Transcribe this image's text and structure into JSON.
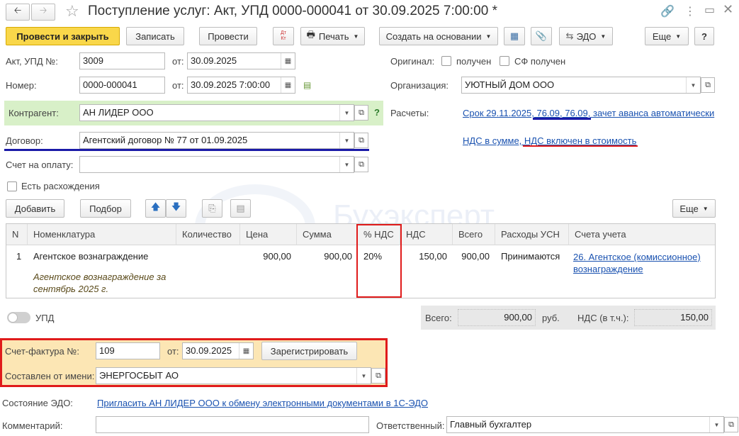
{
  "window": {
    "title": "Поступление услуг: Акт, УПД 0000-000041 от 30.09.2025 7:00:00 *"
  },
  "toolbar": {
    "post_close": "Провести и закрыть",
    "save": "Записать",
    "post": "Провести",
    "dt_kt": "Дт Кт",
    "print": "Печать",
    "create_based": "Создать на основании",
    "edo": "ЭДО",
    "more": "Еще",
    "help": "?"
  },
  "header": {
    "act_label": "Акт, УПД №:",
    "act_number": "3009",
    "from_label": "от:",
    "act_date": "30.09.2025",
    "number_label": "Номер:",
    "number_value": "0000-000041",
    "number_date": "30.09.2025  7:00:00",
    "original_label": "Оригинал:",
    "received_label": "получен",
    "sf_received_label": "СФ получен",
    "org_label": "Организация:",
    "org_value": "УЮТНЫЙ ДОМ ООО",
    "counterparty_label": "Контрагент:",
    "counterparty_value": "АН ЛИДЕР ООО",
    "help_q": "?",
    "settlements_label": "Расчеты:",
    "settlements_link": "Срок 29.11.2025, 76.09, 76.09, зачет аванса автоматически",
    "contract_label": "Договор:",
    "contract_value": "Агентский договор № 77 от 01.09.2025",
    "vat_link": "НДС в сумме, НДС включен в стоимость",
    "invoice_label": "Счет на оплату:",
    "invoice_value": "",
    "discrepancy_label": "Есть расхождения"
  },
  "table_toolbar": {
    "add": "Добавить",
    "pick": "Подбор",
    "more": "Еще"
  },
  "watermark": "Бухэксперт",
  "table": {
    "headers": [
      "N",
      "Номенклатура",
      "Количество",
      "Цена",
      "Сумма",
      "% НДС",
      "НДС",
      "Всего",
      "Расходы УСН",
      "Счета учета"
    ],
    "rows": [
      {
        "n": "1",
        "name": "Агентское вознаграждение",
        "content": "Агентское вознаграждение за сентябрь 2025 г.",
        "quantity": "",
        "price": "900,00",
        "sum": "900,00",
        "vat_rate": "20%",
        "vat": "150,00",
        "total": "900,00",
        "usn": "Принимаются",
        "account": "26. Агентское (комиссионное) вознаграждение"
      }
    ]
  },
  "totals": {
    "upd_label": "УПД",
    "total_label": "Всего:",
    "total_value": "900,00",
    "currency": "руб.",
    "vat_label": "НДС (в т.ч.):",
    "vat_value": "150,00"
  },
  "sf": {
    "number_label": "Счет-фактура №:",
    "number_value": "109",
    "from_label": "от:",
    "date_value": "30.09.2025",
    "register_button": "Зарегистрировать",
    "issuer_label": "Составлен от имени:",
    "issuer_value": "ЭНЕРГОСБЫТ АО"
  },
  "footer": {
    "edo_label": "Состояние ЭДО:",
    "edo_link": "Пригласить АН ЛИДЕР ООО к обмену электронными документами в 1С-ЭДО",
    "comment_label": "Комментарий:",
    "comment_value": "",
    "responsible_label": "Ответственный:",
    "responsible_value": "Главный бухгалтер"
  },
  "colors": {
    "primary_button": "#f9d74a",
    "counterparty_highlight": "#d8f0c8",
    "sf_highlight": "#fce6b4",
    "annotation_red": "#e01b1b",
    "annotation_blue": "#1a1aa8",
    "link": "#1a52b0"
  }
}
